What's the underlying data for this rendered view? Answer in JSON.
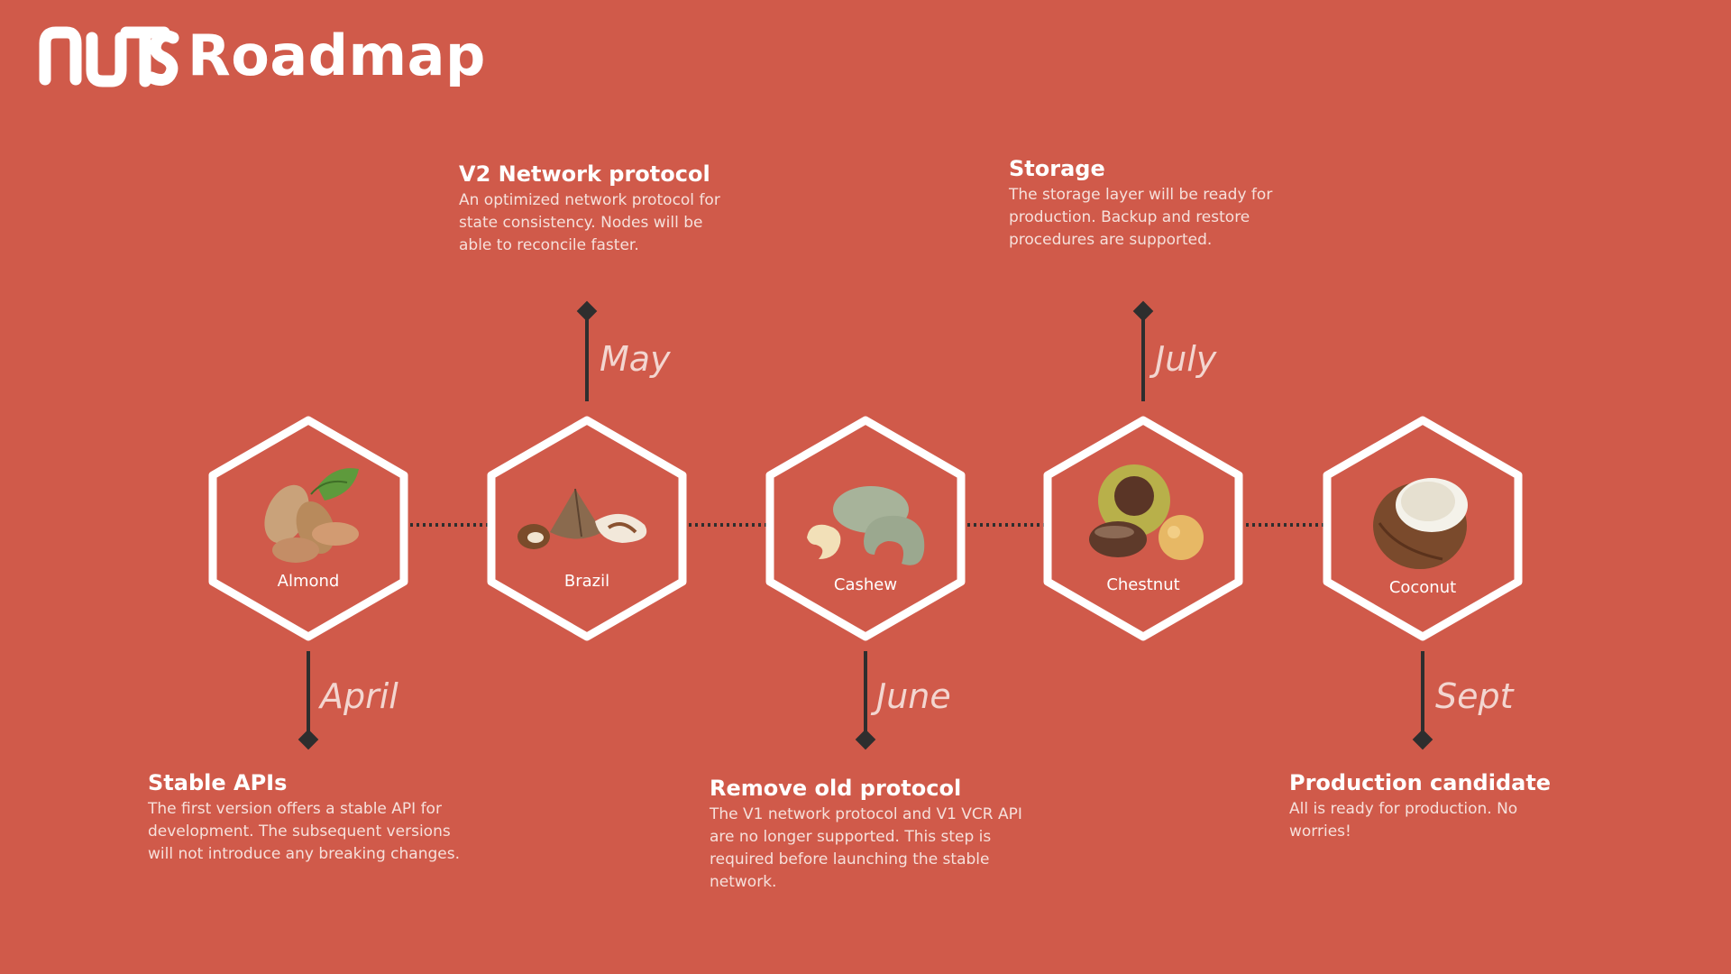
{
  "header": {
    "logo_text": "nuts",
    "title": "Roadmap"
  },
  "colors": {
    "background": "#D05A4A",
    "connector": "#2E2E2E",
    "hexagon_stroke": "#FFFFFF"
  },
  "nuts": [
    {
      "name": "Almond",
      "icon": "almond-icon"
    },
    {
      "name": "Brazil",
      "icon": "brazil-nut-icon"
    },
    {
      "name": "Cashew",
      "icon": "cashew-icon"
    },
    {
      "name": "Chestnut",
      "icon": "chestnut-icon"
    },
    {
      "name": "Coconut",
      "icon": "coconut-icon"
    }
  ],
  "milestones": [
    {
      "month": "April",
      "title": "Stable APIs",
      "description": "The first version offers a stable API for development. The subsequent versions will not introduce any breaking changes."
    },
    {
      "month": "May",
      "title": "V2 Network protocol",
      "description": "An optimized network protocol for state consistency. Nodes will be able to reconcile faster."
    },
    {
      "month": "June",
      "title": "Remove old protocol",
      "description": "The V1 network protocol and V1 VCR API are no longer supported. This step is required before launching the stable network."
    },
    {
      "month": "July",
      "title": "Storage",
      "description": "The storage layer will be ready for production. Backup and restore procedures are supported."
    },
    {
      "month": "Sept",
      "title": "Production candidate",
      "description": "All is ready for production. No worries!"
    }
  ]
}
